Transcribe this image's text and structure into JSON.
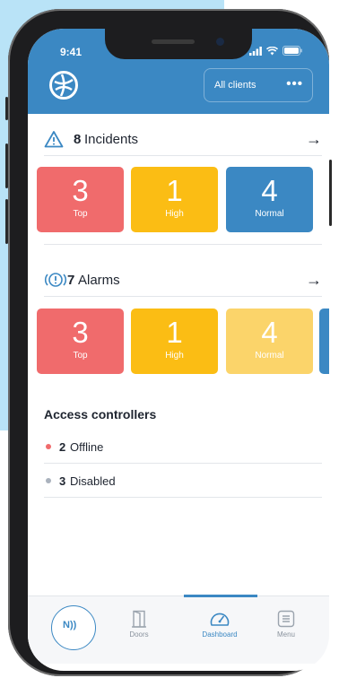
{
  "status_bar": {
    "time": "9:41"
  },
  "header": {
    "client_selector": "All clients",
    "more": "•••"
  },
  "incidents": {
    "count": "8",
    "label": "Incidents",
    "tiles": [
      {
        "value": "3",
        "label": "Top",
        "color": "#f06b6c"
      },
      {
        "value": "1",
        "label": "High",
        "color": "#fbbd14"
      },
      {
        "value": "4",
        "label": "Normal",
        "color": "#3b88c3"
      }
    ]
  },
  "alarms": {
    "count": "7",
    "label": "Alarms",
    "tiles": [
      {
        "value": "3",
        "label": "Top",
        "color": "#f06b6c"
      },
      {
        "value": "1",
        "label": "High",
        "color": "#fbbd14"
      },
      {
        "value": "4",
        "label": "Normal",
        "color": "#fbd46a"
      }
    ]
  },
  "access_controllers": {
    "title": "Access controllers",
    "rows": [
      {
        "count": "2",
        "label": "Offline",
        "dot_color": "#f06b6c"
      },
      {
        "count": "3",
        "label": "Disabled",
        "dot_color": "#aab2bd"
      }
    ]
  },
  "tabbar": {
    "nfc_label": "N))",
    "tabs": [
      {
        "label": "Doors",
        "active": false
      },
      {
        "label": "Dashboard",
        "active": true
      },
      {
        "label": "Menu",
        "active": false
      }
    ]
  },
  "icons": {
    "logo": "globe-logo-icon",
    "warning": "warning-triangle-icon",
    "alarm": "alarm-icon",
    "arrow": "arrow-right-icon",
    "doors": "door-icon",
    "dashboard": "gauge-icon",
    "menu": "menu-icon"
  },
  "colors": {
    "accent": "#3b88c3",
    "top": "#f06b6c",
    "high": "#fbbd14"
  }
}
